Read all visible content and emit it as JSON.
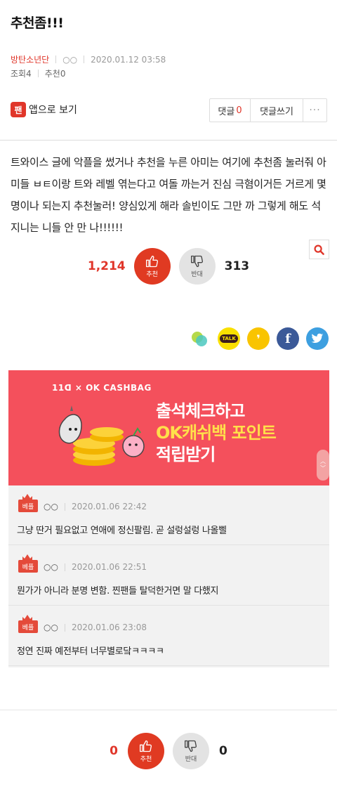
{
  "post": {
    "title": "추천좀!!!",
    "board": "방탄소년단",
    "author": "○○",
    "date": "2020.01.12 03:58",
    "views_label": "조회",
    "views": "4",
    "recommend_label": "추천",
    "recommends": "0",
    "body": "트와이스 글에 악플을 썼거나 추천을 누른 아미는 여기에 추천좀 눌러줘 아미들 ㅂㅌ이랑 트와 레벨 엮는다고 여돌 까는거 진심 극혐이거든 거르게 몇명이나 되는지 추천눌러! 양심있게 해라 솔빈이도 그만 까 그렇게 해도 석지니는 니들 안 만 나!!!!!!"
  },
  "toolbar": {
    "app_icon_text": "팬",
    "app_label": "앱으로 보기",
    "comment_label": "댓글",
    "comment_count": "0",
    "write_label": "댓글쓰기",
    "more_label": "···"
  },
  "votes_top": {
    "up_count": "1,214",
    "up_label": "추천",
    "down_label": "반대",
    "down_count": "313"
  },
  "share": {
    "talk_label": "TALK",
    "story_label": "❜",
    "fb_label": "f"
  },
  "banner": {
    "brand": "11ᗡ × OK CASHBAG",
    "line1": "출석체크하고",
    "line2": "OK캐쉬백 포인트",
    "line3": "적립받기",
    "scroll_up": "︿",
    "scroll_down": "﹀"
  },
  "best_badge": "베플",
  "comments": [
    {
      "author": "○○",
      "date": "2020.01.06 22:42",
      "text": "그냥 딴거 필요없고 연애에 정신팔림. 곧 설렁설렁 나올삘"
    },
    {
      "author": "○○",
      "date": "2020.01.06 22:51",
      "text": "뭔가가 아니라 분명 변함. 찐팬들 탈덕한거면 말 다했지"
    },
    {
      "author": "○○",
      "date": "2020.01.06 23:08",
      "text": "정연 진짜 예전부터 너무별로닼ㅋㅋㅋㅋ"
    }
  ],
  "votes_bottom": {
    "up_count": "0",
    "up_label": "추천",
    "down_label": "반대",
    "down_count": "0"
  },
  "colors": {
    "accent": "#e0362a",
    "banner_bg": "#f4505c",
    "banner_highlight": "#ffe04a"
  }
}
